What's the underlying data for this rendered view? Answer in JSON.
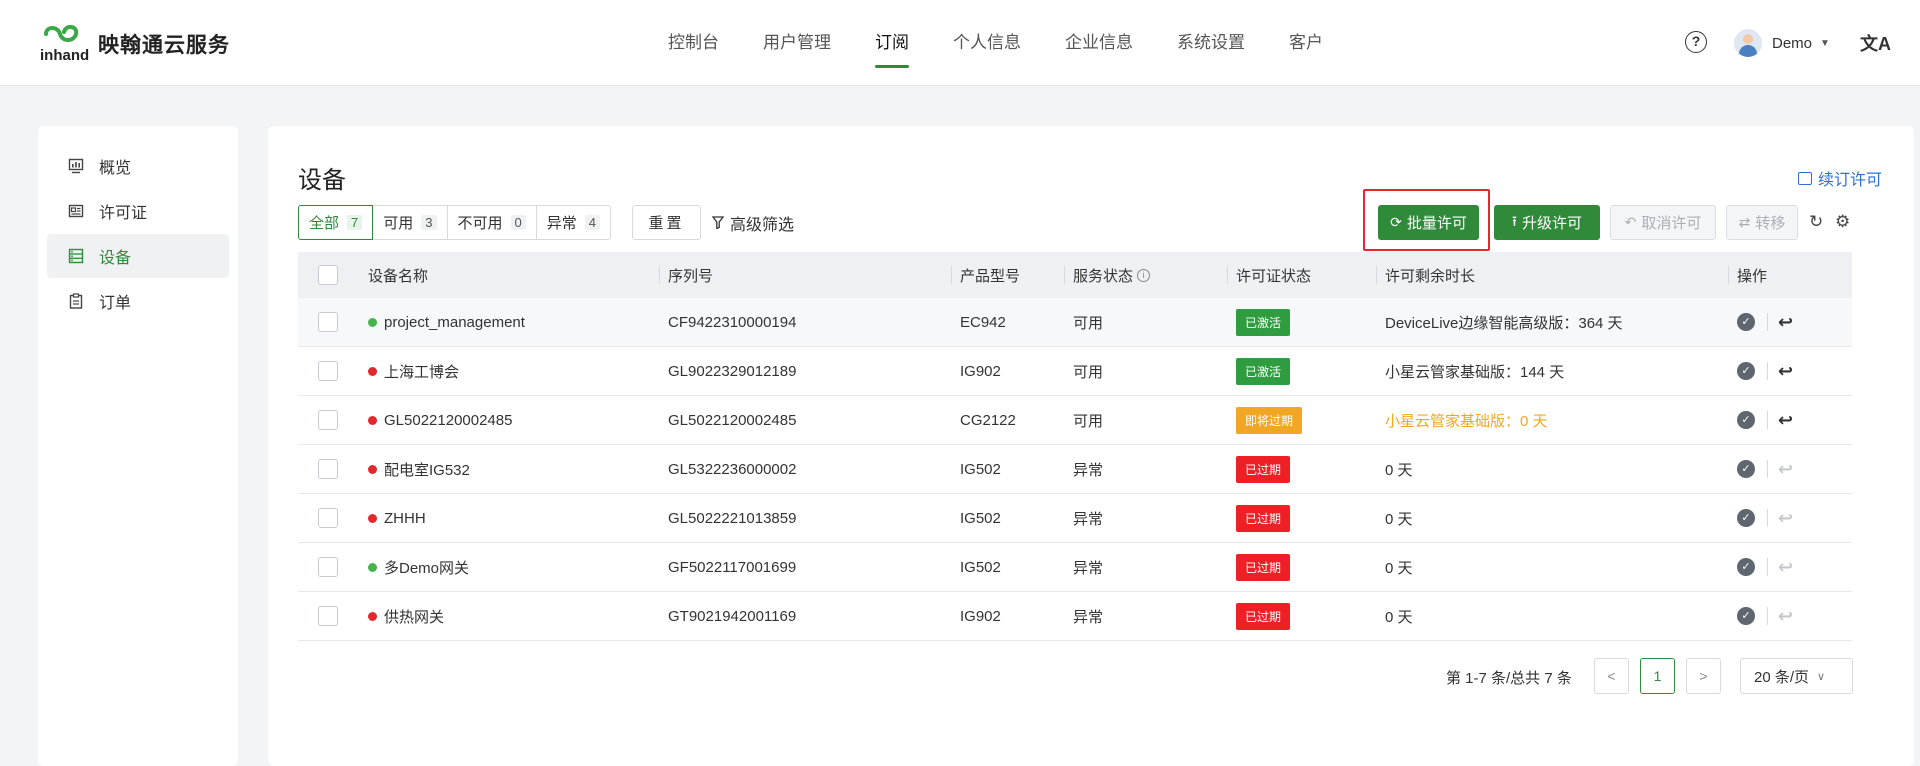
{
  "header": {
    "brand": "映翰通云服务",
    "logo_text": "inhand",
    "nav": [
      {
        "label": "控制台",
        "active": false
      },
      {
        "label": "用户管理",
        "active": false
      },
      {
        "label": "订阅",
        "active": true
      },
      {
        "label": "个人信息",
        "active": false
      },
      {
        "label": "企业信息",
        "active": false
      },
      {
        "label": "系统设置",
        "active": false
      },
      {
        "label": "客户",
        "active": false
      }
    ],
    "help_icon": "?",
    "user_name": "Demo",
    "lang_icon": "文A"
  },
  "sidebar": {
    "items": [
      {
        "label": "概览",
        "icon": "monitor-icon",
        "active": false
      },
      {
        "label": "许可证",
        "icon": "license-icon",
        "active": false
      },
      {
        "label": "设备",
        "icon": "device-list-icon",
        "active": true
      },
      {
        "label": "订单",
        "icon": "clipboard-icon",
        "active": false
      }
    ]
  },
  "main": {
    "title": "设备",
    "renew_link": "续订许可",
    "filters": [
      {
        "label": "全部",
        "count": "7",
        "active": true
      },
      {
        "label": "可用",
        "count": "3",
        "active": false
      },
      {
        "label": "不可用",
        "count": "0",
        "active": false
      },
      {
        "label": "异常",
        "count": "4",
        "active": false
      }
    ],
    "reset": "重置",
    "advanced_filter": "高级筛选",
    "actions": {
      "batch_license": "批量许可",
      "upgrade_license": "升级许可",
      "cancel_license": "取消许可",
      "transfer": "转移"
    },
    "columns": [
      "设备名称",
      "序列号",
      "产品型号",
      "服务状态",
      "许可证状态",
      "许可剩余时长",
      "操作"
    ],
    "rows": [
      {
        "name": "project_management",
        "online": true,
        "sn": "CF9422310000194",
        "model": "EC942",
        "service": "可用",
        "license": "已激活",
        "license_color": "green",
        "remaining": "DeviceLive边缘智能高级版：364 天",
        "warn": false,
        "undo_enabled": true
      },
      {
        "name": "上海工博会",
        "online": false,
        "sn": "GL9022329012189",
        "model": "IG902",
        "service": "可用",
        "license": "已激活",
        "license_color": "green",
        "remaining": "小星云管家基础版：144 天",
        "warn": false,
        "undo_enabled": true
      },
      {
        "name": "GL5022120002485",
        "online": false,
        "sn": "GL5022120002485",
        "model": "CG2122",
        "service": "可用",
        "license": "即将过期",
        "license_color": "orange",
        "remaining": "小星云管家基础版：0 天",
        "warn": true,
        "undo_enabled": true
      },
      {
        "name": "配电室IG532",
        "online": false,
        "sn": "GL5322236000002",
        "model": "IG502",
        "service": "异常",
        "license": "已过期",
        "license_color": "red",
        "remaining": "0 天",
        "warn": false,
        "undo_enabled": false
      },
      {
        "name": "ZHHH",
        "online": false,
        "sn": "GL5022221013859",
        "model": "IG502",
        "service": "异常",
        "license": "已过期",
        "license_color": "red",
        "remaining": "0 天",
        "warn": false,
        "undo_enabled": false
      },
      {
        "name": "多Demo网关",
        "online": true,
        "sn": "GF5022117001699",
        "model": "IG502",
        "service": "异常",
        "license": "已过期",
        "license_color": "red",
        "remaining": "0 天",
        "warn": false,
        "undo_enabled": false
      },
      {
        "name": "供热网关",
        "online": false,
        "sn": "GT9021942001169",
        "model": "IG902",
        "service": "异常",
        "license": "已过期",
        "license_color": "red",
        "remaining": "0 天",
        "warn": false,
        "undo_enabled": false
      }
    ],
    "pagination": {
      "total_text": "第 1-7 条/总共 7 条",
      "current_page": "1",
      "page_size": "20 条/页"
    }
  },
  "colors": {
    "primary_green": "#2f8a3a",
    "warning_orange": "#f2a724",
    "danger_red": "#ee2025",
    "link_blue": "#2e6fd6"
  }
}
